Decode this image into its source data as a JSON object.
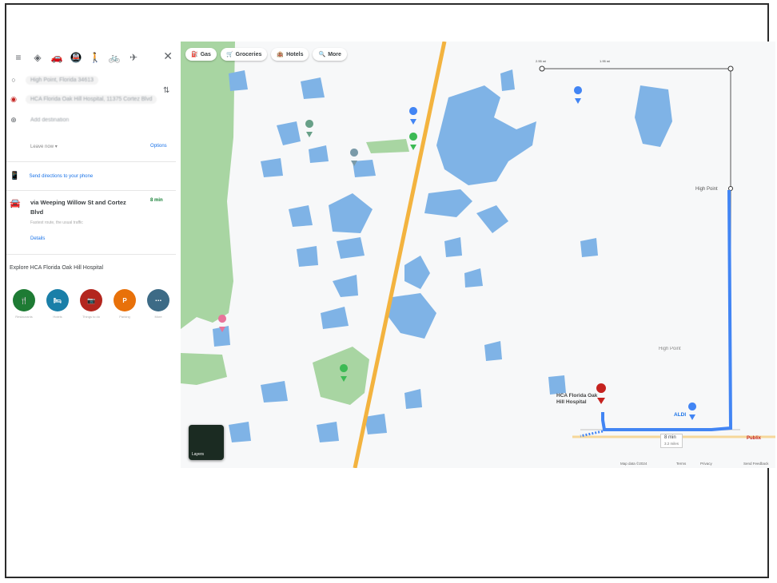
{
  "sidebar": {
    "close": "✕",
    "origin": "High Point, Florida 34613",
    "destination": "HCA Florida Oak Hill Hospital, 11375 Cortez Blvd",
    "add_destination": "Add destination",
    "leave_now": "Leave now ▾",
    "options": "Options",
    "send_directions": "Send directions to your phone",
    "route": {
      "title": "via Weeping Willow St and Cortez Blvd",
      "time": "8 min",
      "subtitle": "Fastest route, the usual traffic",
      "distance": "3.2 miles"
    },
    "details": "Details",
    "explore_title": "Explore HCA Florida Oak Hill Hospital",
    "explore": [
      {
        "glyph": "🍴",
        "label": "Restaurants",
        "color": "#1e7b34"
      },
      {
        "glyph": "🛏",
        "label": "Hotels",
        "color": "#1a7fa8"
      },
      {
        "glyph": "📷",
        "label": "Things to do",
        "color": "#b3261e"
      },
      {
        "glyph": "P",
        "label": "Parking",
        "color": "#e8710a"
      },
      {
        "glyph": "⋯",
        "label": "More",
        "color": "#3d6b86"
      }
    ]
  },
  "chips": [
    {
      "icon": "⛽",
      "label": "Gas"
    },
    {
      "icon": "🛒",
      "label": "Groceries"
    },
    {
      "icon": "🏨",
      "label": "Hotels"
    },
    {
      "icon": "🔍",
      "label": "More"
    }
  ],
  "map": {
    "ruler": {
      "left": "2.55 mi",
      "mid": "1.95 mi"
    },
    "high_point_top": "High Point",
    "high_point_area": "High Point",
    "dest_name": "HCA Florida Oak Hill Hospital",
    "aldi": "ALDI",
    "route_chip": {
      "time": "8 min",
      "dist": "3.2 miles"
    },
    "grocery": "Publix",
    "layers_label": "Layers",
    "footer": [
      "Map data ©2024",
      "Terms",
      "Privacy",
      "Send Feedback"
    ]
  },
  "colors": {
    "water": "#7fb3e6",
    "park": "#a8d5a2",
    "road": "#f3b33f",
    "route": "#4285f4"
  }
}
